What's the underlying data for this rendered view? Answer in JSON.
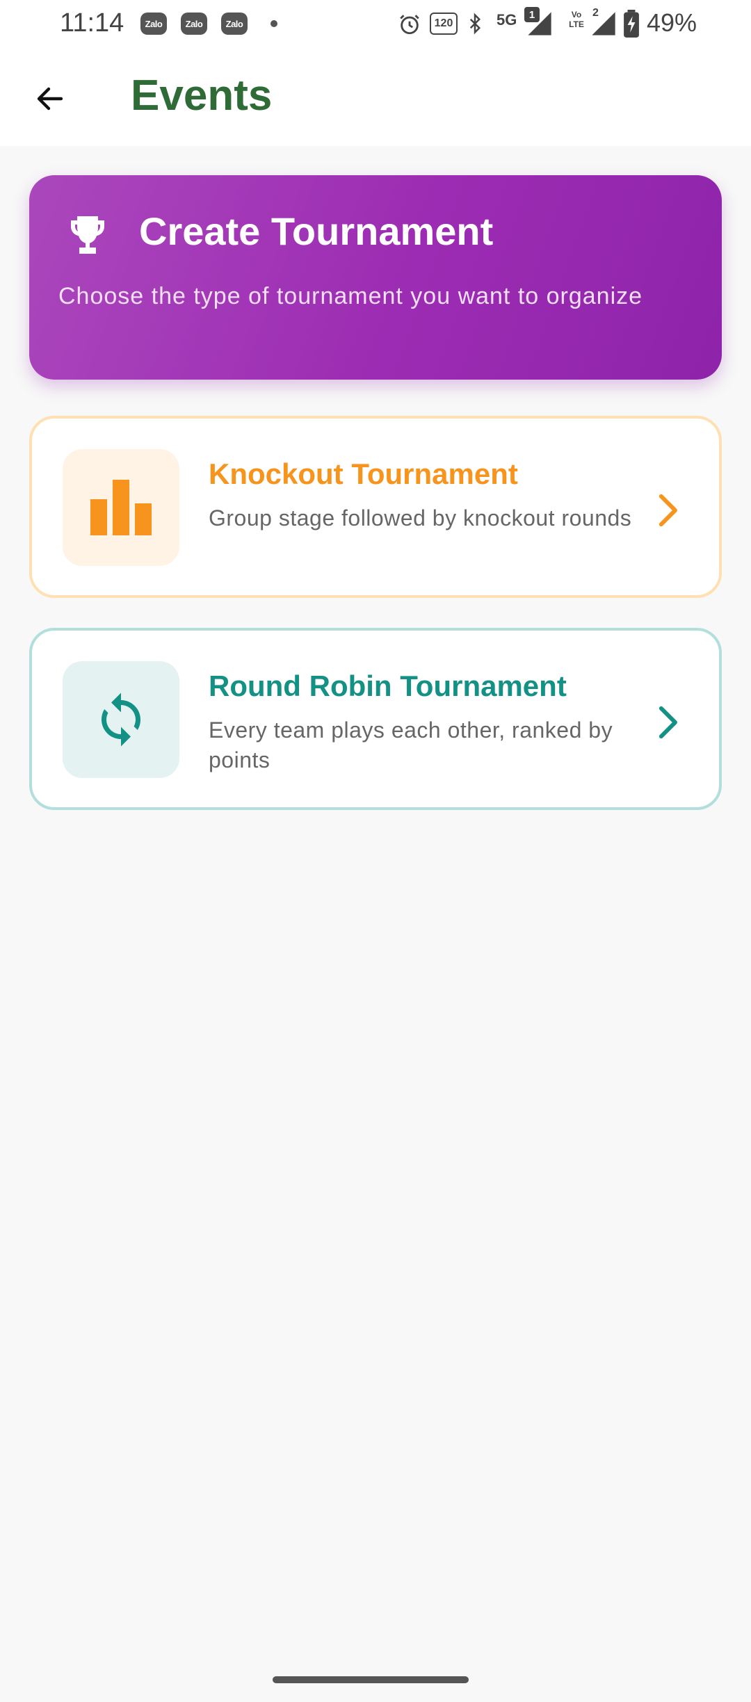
{
  "status_bar": {
    "time": "11:14",
    "notification_apps": [
      "Zalo",
      "Zalo",
      "Zalo"
    ],
    "refresh_rate": "120",
    "network": "5G",
    "sim1_badge": "1",
    "sim2_badge": "2",
    "volte": "Vo LTE",
    "battery": "49%",
    "icons": [
      "alarm-icon",
      "refresh-rate-icon",
      "bluetooth-icon",
      "signal-icon",
      "battery-icon"
    ]
  },
  "app_bar": {
    "title": "Events",
    "back_icon": "arrow-left-icon"
  },
  "banner": {
    "title": "Create Tournament",
    "subtitle": "Choose the type of tournament you want to organize",
    "icon": "trophy-icon"
  },
  "tournament_types": [
    {
      "title": "Knockout Tournament",
      "description": "Group stage followed by knockout rounds",
      "icon": "bar-chart-icon",
      "accent_color": "#F7941D"
    },
    {
      "title": "Round Robin Tournament",
      "description": "Every team plays each other, ranked by points",
      "icon": "sync-icon",
      "accent_color": "#139185"
    }
  ],
  "colors": {
    "title_green": "#2E6B36",
    "banner_purple": "#9C27B0",
    "background": "#F8F8F8"
  }
}
